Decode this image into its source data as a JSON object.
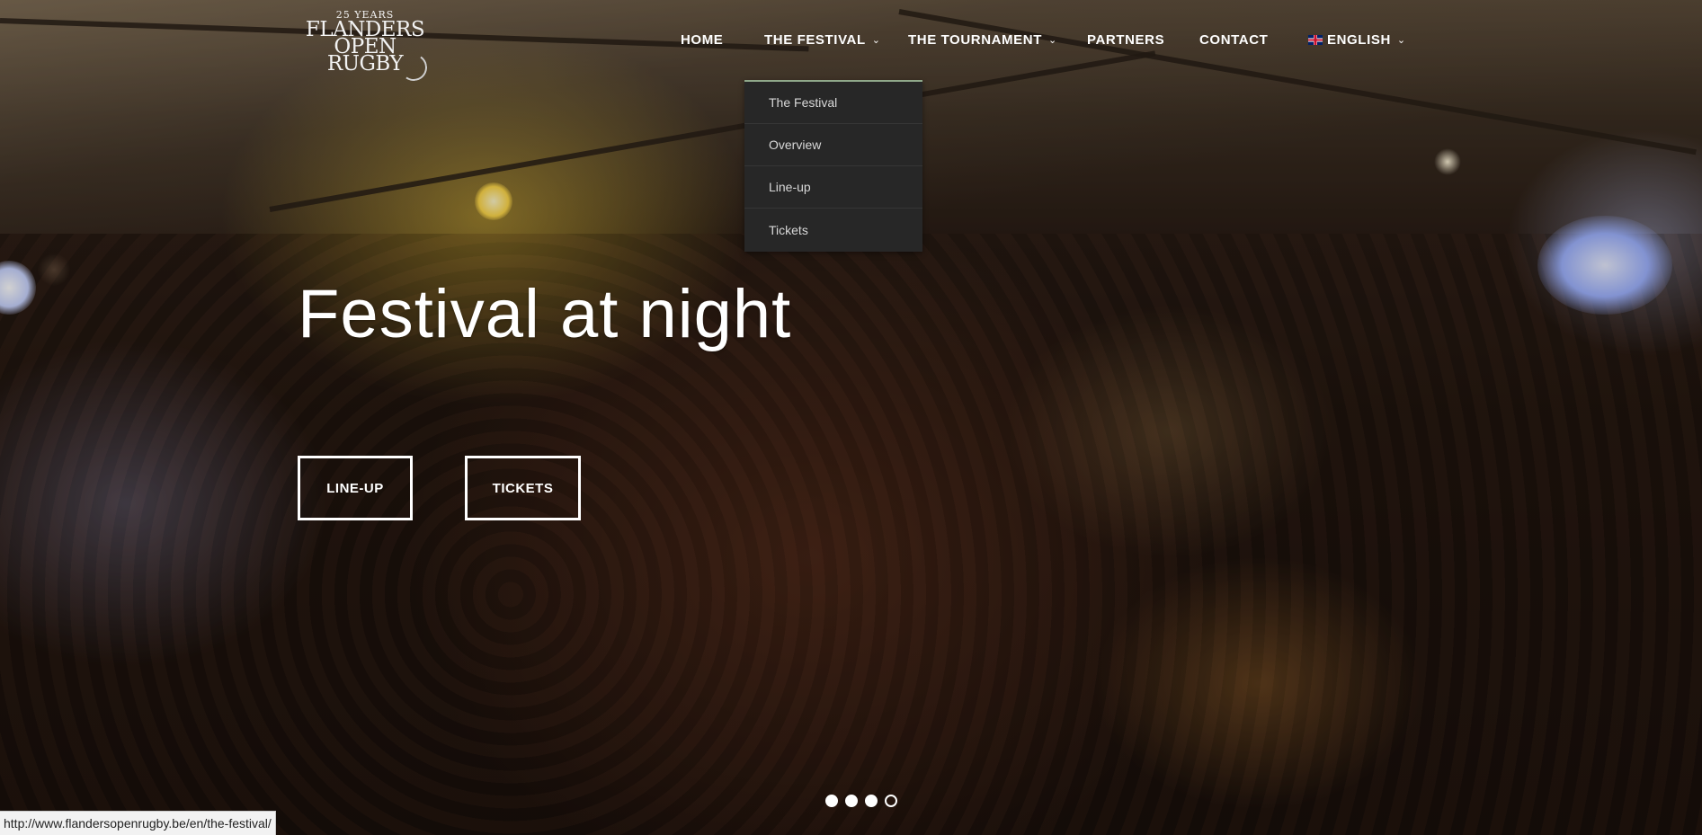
{
  "brand": {
    "logo_years": "25 YEARS",
    "logo_line1": "FLANDERS",
    "logo_line2": "OPEN",
    "logo_line3": "RUGBY"
  },
  "nav": {
    "items": [
      {
        "label": "HOME",
        "has_dropdown": false
      },
      {
        "label": "THE FESTIVAL",
        "has_dropdown": true
      },
      {
        "label": "THE TOURNAMENT",
        "has_dropdown": true
      },
      {
        "label": "PARTNERS",
        "has_dropdown": false
      },
      {
        "label": "CONTACT",
        "has_dropdown": false
      },
      {
        "label": "ENGLISH",
        "has_dropdown": true,
        "icon": "uk-flag-icon"
      }
    ],
    "caret_icon": "chevron-down-icon"
  },
  "dropdown": {
    "parent": "THE FESTIVAL",
    "items": [
      "The Festival",
      "Overview",
      "Line-up",
      "Tickets"
    ]
  },
  "hero": {
    "headline": "Festival at night",
    "buttons": [
      {
        "label": "LINE-UP"
      },
      {
        "label": "TICKETS"
      }
    ],
    "slider": {
      "total_slides": 4,
      "active_slide": 4
    }
  },
  "status_bar": {
    "url": "http://www.flandersopenrugby.be/en/the-festival/"
  },
  "colors": {
    "dropdown_bg": "#272727",
    "dropdown_accent": "#8fa88a",
    "text_light": "#ffffff"
  }
}
